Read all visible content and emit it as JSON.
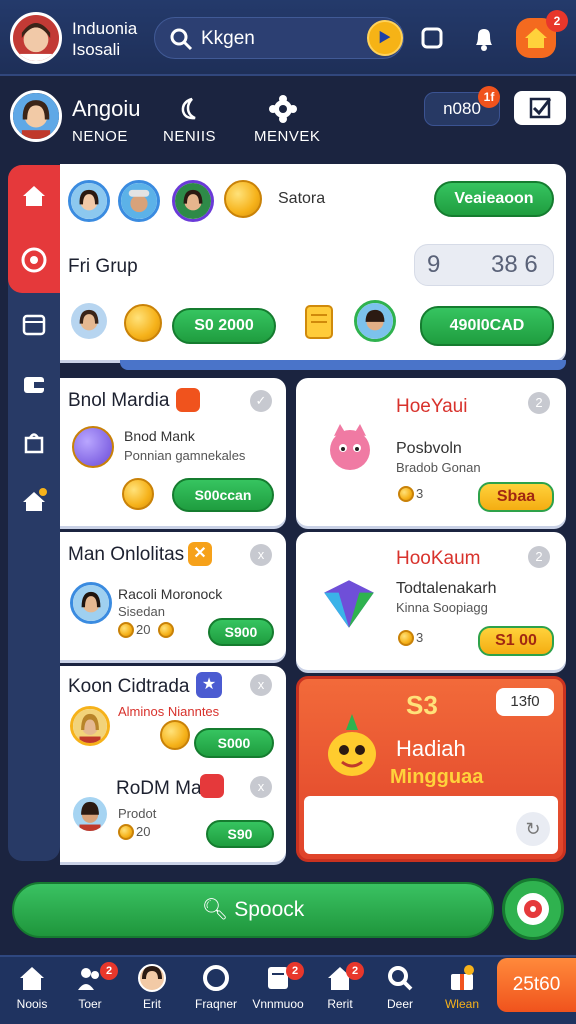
{
  "top": {
    "title_line1": "Induonia",
    "title_line2": "Isosali",
    "search_text": "Kkgen",
    "notif_badge": "2"
  },
  "profile": {
    "name": "Angoiu",
    "tab_left": "NENOE",
    "tab_mid": "NENIIS",
    "tab_right": "MENVEK",
    "coins": "n080",
    "coins_badge": "1f"
  },
  "group_card": {
    "coin_label": "Satora",
    "top_button": "Veaieaoon",
    "title": "Fri Grup",
    "counter_left": "9",
    "counter_right": "38 6",
    "btn_left": "S0 2000",
    "btn_right": "490I0CAD"
  },
  "cards": [
    {
      "title": "Bnol Mardia",
      "subtitle": "Bnod Mank",
      "desc": "Ponnian gamnekales",
      "button": "S00ccan"
    },
    {
      "title": "HoeYaui",
      "subtitle": "Posbvoln",
      "desc": "Bradob Gonan",
      "count": "3",
      "button": "Sbaa",
      "close": "2"
    },
    {
      "title": "Man Onlolitas",
      "subtitle": "Racoli Moronock",
      "desc": "Sisedan",
      "count": "20",
      "button": "S900",
      "close": "x"
    },
    {
      "title": "HooKaum",
      "subtitle": "Todtalenakarh",
      "desc": "Kinna Soopiagg",
      "count": "3",
      "button": "S1 00",
      "close": "2"
    },
    {
      "title": "Koon Cidtrada",
      "subtitle": "Alminos Nianntes",
      "button": "S000",
      "close": "x"
    },
    {
      "title": "RoDM Mai",
      "subtitle": "Prodot",
      "count": "20",
      "button": "S90",
      "close": "x"
    }
  ],
  "promo": {
    "amount": "S3",
    "pill": "13f0",
    "line1": "Hadiah",
    "line2": "Mingguaa"
  },
  "cta": {
    "label": "Spoock"
  },
  "nav": [
    {
      "label": "Noois"
    },
    {
      "label": "Toer",
      "badge": "2"
    },
    {
      "label": "Erit"
    },
    {
      "label": "Fraqner"
    },
    {
      "label": "Vnnmuoo",
      "badge": "2"
    },
    {
      "label": "Rerit",
      "badge": "2"
    },
    {
      "label": "Deer"
    },
    {
      "label": "Wlean"
    }
  ],
  "nav_orange": "25t60",
  "colors": {
    "brand_green": "#2fb24f",
    "accent_red": "#e5393b",
    "navy": "#1b2440",
    "gold": "#f6b21a"
  }
}
